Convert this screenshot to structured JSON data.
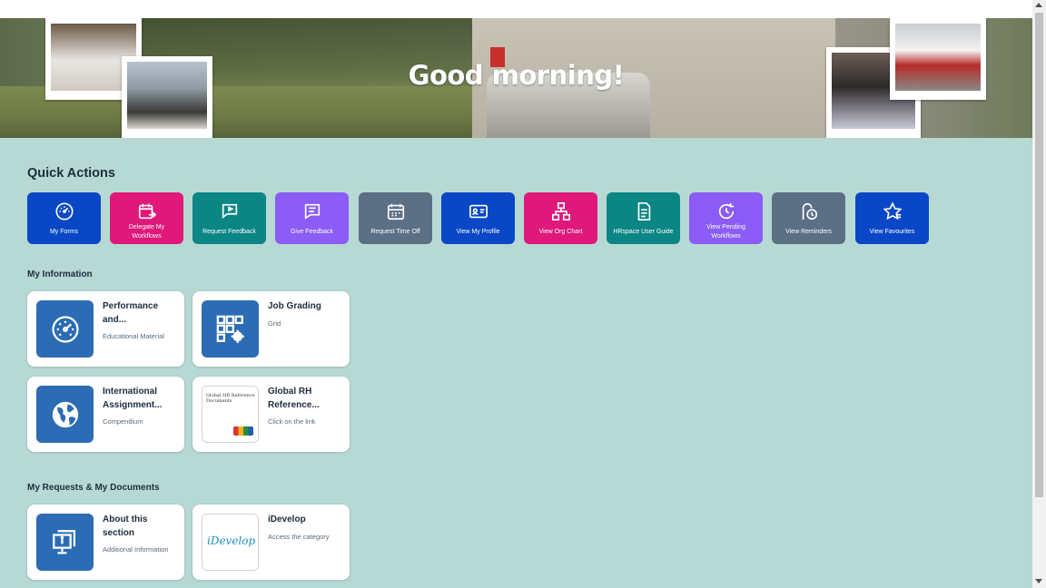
{
  "hero": {
    "greeting": "Good morning!"
  },
  "quick_actions": {
    "title": "Quick Actions",
    "items": [
      {
        "label": "My Forms",
        "icon": "gauge-icon",
        "color": "#0a47c7"
      },
      {
        "label": "Delegate My Workflows",
        "icon": "calendar-delegate-icon",
        "color": "#e0187a"
      },
      {
        "label": "Request Feedback",
        "icon": "feedback-request-icon",
        "color": "#0c8585"
      },
      {
        "label": "Give Feedback",
        "icon": "message-icon",
        "color": "#8b5cf6"
      },
      {
        "label": "Request Time Off",
        "icon": "calendar-icon",
        "color": "#5b6f85"
      },
      {
        "label": "View My Profile",
        "icon": "id-card-icon",
        "color": "#0a47c7"
      },
      {
        "label": "View Org Chart",
        "icon": "org-chart-icon",
        "color": "#e0187a"
      },
      {
        "label": "HRspace User Guide",
        "icon": "document-icon",
        "color": "#0c8585"
      },
      {
        "label": "View Pending Workflows",
        "icon": "refresh-icon",
        "color": "#8b5cf6"
      },
      {
        "label": "View Reminders",
        "icon": "reminder-icon",
        "color": "#5b6f85"
      },
      {
        "label": "View Favourites",
        "icon": "star-icon",
        "color": "#0a47c7"
      }
    ]
  },
  "my_information": {
    "title": "My Information",
    "tiles": [
      {
        "title": "Performance and...",
        "subtitle": "Educational Material",
        "icon": "gauge-icon"
      },
      {
        "title": "Job Grading",
        "subtitle": "Grid",
        "icon": "grid-settings-icon"
      },
      {
        "title": "International Assignment...",
        "subtitle": "Compendium",
        "icon": "globe-icon"
      },
      {
        "title": "Global RH Reference...",
        "subtitle": "Click on the link",
        "icon": "global-hr-document-thumbnail",
        "thumb_text": "Global HR Reference Documents"
      }
    ]
  },
  "my_requests": {
    "title": "My Requests & My Documents",
    "tiles": [
      {
        "title": "About this section",
        "subtitle": "Additional Information",
        "icon": "monitor-info-icon"
      },
      {
        "title": "iDevelop",
        "subtitle": "Access the category",
        "icon": "idevelop-logo",
        "thumb_text": "iDevelop"
      }
    ]
  }
}
